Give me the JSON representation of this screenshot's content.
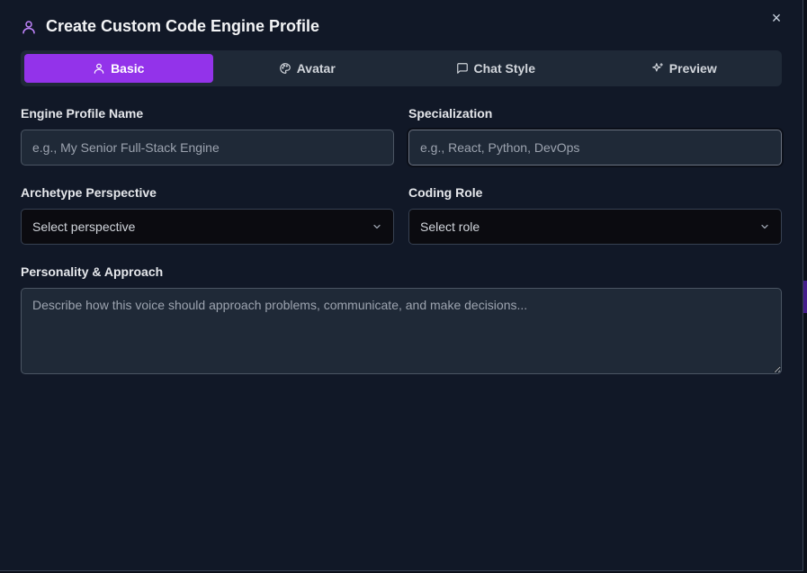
{
  "dialog": {
    "title": "Create Custom Code Engine Profile",
    "close_label": "×",
    "accent_color": "#9333ea",
    "icon": "user-icon"
  },
  "tabs": [
    {
      "label": "Basic",
      "icon": "user-icon",
      "active": true
    },
    {
      "label": "Avatar",
      "icon": "palette-icon",
      "active": false
    },
    {
      "label": "Chat Style",
      "icon": "chat-bubble-icon",
      "active": false
    },
    {
      "label": "Preview",
      "icon": "sparkles-icon",
      "active": false
    }
  ],
  "form": {
    "name": {
      "label": "Engine Profile Name",
      "placeholder": "e.g., My Senior Full-Stack Engine",
      "value": ""
    },
    "specialization": {
      "label": "Specialization",
      "placeholder": "e.g., React, Python, DevOps",
      "value": ""
    },
    "perspective": {
      "label": "Archetype Perspective",
      "selected": "Select perspective"
    },
    "role": {
      "label": "Coding Role",
      "selected": "Select role"
    },
    "personality": {
      "label": "Personality & Approach",
      "placeholder": "Describe how this voice should approach problems, communicate, and make decisions...",
      "value": ""
    }
  }
}
